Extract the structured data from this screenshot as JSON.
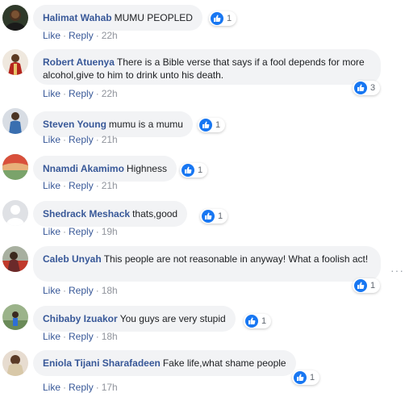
{
  "comments": [
    {
      "author": "Halimat Wahab",
      "text": "MUMU PEOPLED",
      "likes": "1",
      "like_label": "Like",
      "reply_label": "Reply",
      "time": "22h"
    },
    {
      "author": "Robert Atuenya",
      "text": "There is a Bible verse that says if a fool depends for more alcohol,give to him to drink unto his death.",
      "likes": "3",
      "like_label": "Like",
      "reply_label": "Reply",
      "time": "22h"
    },
    {
      "author": "Steven Young",
      "text": "mumu is a mumu",
      "likes": "1",
      "like_label": "Like",
      "reply_label": "Reply",
      "time": "21h"
    },
    {
      "author": "Nnamdi Akamimo",
      "text": "Highness",
      "likes": "1",
      "like_label": "Like",
      "reply_label": "Reply",
      "time": "21h"
    },
    {
      "author": "Shedrack Meshack",
      "text": "thats,good",
      "likes": "1",
      "like_label": "Like",
      "reply_label": "Reply",
      "time": "19h"
    },
    {
      "author": "Caleb Unyah",
      "text": "This people are not reasonable in anyway! What a foolish act!",
      "likes": "1",
      "like_label": "Like",
      "reply_label": "Reply",
      "time": "18h"
    },
    {
      "author": "Chibaby Izuakor",
      "text": "You guys are very stupid",
      "likes": "1",
      "like_label": "Like",
      "reply_label": "Reply",
      "time": "18h"
    },
    {
      "author": "Eniola Tijani Sharafadeen",
      "text": "Fake life,what shame people",
      "likes": "1",
      "like_label": "Like",
      "reply_label": "Reply",
      "time": "17h"
    }
  ],
  "more_options": "···",
  "colors": {
    "author": "#385898",
    "bubble": "#f2f3f5",
    "like_blue": "#1877f2",
    "meta": "#90949c"
  }
}
